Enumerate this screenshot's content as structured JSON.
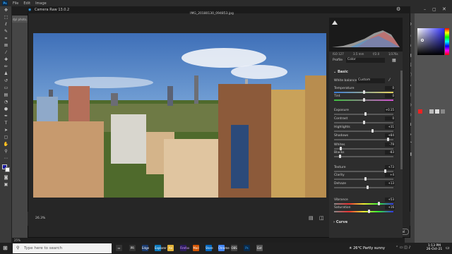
{
  "photoshop": {
    "menu": [
      "File",
      "Edit",
      "Image"
    ],
    "doc_tab": "dpl photo...",
    "logo": "Ps",
    "zoom_bottom": "25%"
  },
  "camera_raw": {
    "title": "Camera Raw 13.0.2",
    "filename": "IMG_20180130_094853.jpg",
    "zoom": "26.3%",
    "ok_label": "OK",
    "cancel_label": "Cancel",
    "histogram": {
      "iso": "ISO 127",
      "focal": "3.5 mm",
      "aperture": "f/2.0",
      "shutter": "1/376s"
    },
    "profile_label": "Profile",
    "profile_value": "Color",
    "basic_title": "Basic",
    "white_balance_label": "White balance",
    "white_balance_value": "Custom",
    "curve_title": "Curve",
    "sliders": [
      {
        "label": "Temperature",
        "value": "0",
        "pos": 0.5
      },
      {
        "label": "Tint",
        "value": "0",
        "pos": 0.5
      },
      {
        "label": "Exposure",
        "value": "+0.15",
        "pos": 0.52
      },
      {
        "label": "Contrast",
        "value": "0",
        "pos": 0.5
      },
      {
        "label": "Highlights",
        "value": "+31",
        "pos": 0.65
      },
      {
        "label": "Shadows",
        "value": "+84",
        "pos": 0.92
      },
      {
        "label": "Whites",
        "value": "-79",
        "pos": 0.1
      },
      {
        "label": "Blacks",
        "value": "-83",
        "pos": 0.08
      },
      {
        "label": "Texture",
        "value": "+73",
        "pos": 0.86
      },
      {
        "label": "Clarity",
        "value": "+4",
        "pos": 0.52
      },
      {
        "label": "Dehaze",
        "value": "+13",
        "pos": 0.56
      },
      {
        "label": "Vibrance",
        "value": "+53",
        "pos": 0.76
      },
      {
        "label": "Saturation",
        "value": "+16",
        "pos": 0.58
      }
    ]
  },
  "taskbar": {
    "search_placeholder": "Type here to search",
    "weather": "26°C  Partly sunny",
    "time": "1:13 PM",
    "date": "26-Oct-21",
    "apps": [
      "PR",
      "Edge",
      "Explorer",
      "Ae",
      "Firefox",
      "Mail",
      "Store",
      "Chrome",
      "OBS",
      "Ps",
      "Ext"
    ]
  },
  "colors": {
    "accent": "#31a8ff",
    "ok_button": "#1473e6",
    "canvas_sky": "#5a8fd0"
  }
}
